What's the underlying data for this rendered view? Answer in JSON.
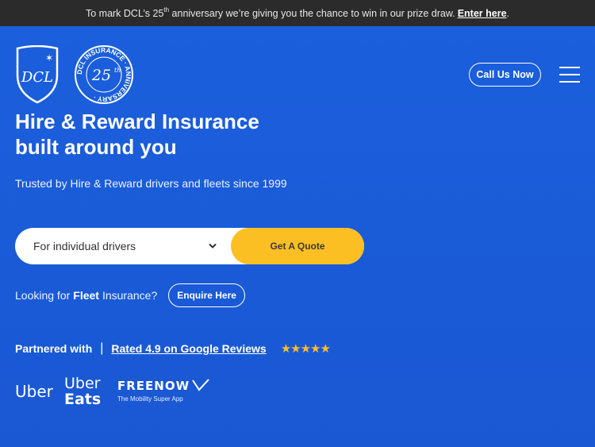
{
  "announcement": {
    "text_before": "To mark DCL’s 25",
    "sup": "th",
    "text_after": " anniversary we’re giving you the chance to win in our prize draw.",
    "link": "Enter here",
    "end": "."
  },
  "header": {
    "logo_shield_text": "DCL",
    "seal_ring_text": "DCL INSURANCE · ANNIVERSARY ·",
    "seal_number": "25",
    "seal_sup": "th",
    "call_label": "Call Us Now"
  },
  "hero": {
    "headline_line1": "Hire & Reward Insurance",
    "headline_line2": "built around you",
    "subhead": "Trusted by Hire & Reward drivers and fleets since 1999"
  },
  "quote": {
    "select_value": "For individual drivers",
    "button_label": "Get A Quote"
  },
  "fleet": {
    "prefix": "Looking for",
    "bold": "Fleet",
    "suffix": "Insurance?",
    "button_label": "Enquire Here"
  },
  "partners": {
    "label": "Partnered with",
    "separator": "|",
    "rating_text": "Rated 4.9 on Google Reviews",
    "stars": "★★★★★",
    "logos": {
      "uber": "Uber",
      "ubereats_1": "Uber",
      "ubereats_2": "Eats",
      "freenow": "FREENOW",
      "freenow_tag": "The Mobility Super App"
    }
  },
  "colors": {
    "hero_bg": "#1a5bd8",
    "topbar_bg": "#2b2b2b",
    "accent_yellow": "#fbbf24",
    "white": "#ffffff"
  }
}
